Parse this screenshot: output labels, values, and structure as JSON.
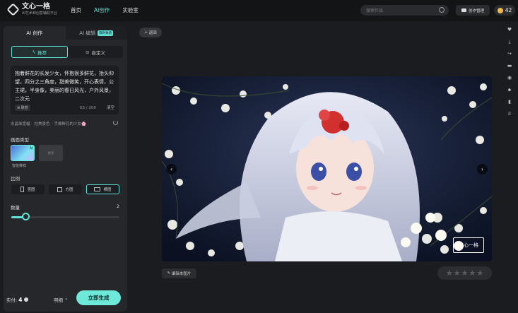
{
  "header": {
    "logo_title": "文心一格",
    "logo_sub": "AI艺术和创意辅助平台",
    "nav": [
      "首页",
      "AI创作",
      "实验室"
    ],
    "nav_active": 1,
    "search_placeholder": "搜索作品",
    "manage_label": "创作管理",
    "coins": "42"
  },
  "panel": {
    "tab_create": "AI 创作",
    "tab_edit": "AI 编辑",
    "tab_edit_badge": "限时体验",
    "mode_recommend": "推荐",
    "mode_custom": "自定义",
    "prompt": "抱着鲜花的长发少女，怀抱很多鲜花，抬头仰望，四分之三角度，甜美微笑，开心表情，公主裙，半身像，美丽的春日风光，户外风景，二次元",
    "assoc_label": "联想",
    "char_count": "63 / 200",
    "clear_label": "清空",
    "suggestions": [
      "水晶球宽幅",
      "柱美景色",
      "手捧鲜花的少女🌸"
    ],
    "style_label": "画面类型",
    "style_card_caption": "智能推荐",
    "style_more": "更多",
    "ratio_label": "比例",
    "ratios": [
      "竖图",
      "方图",
      "横图"
    ],
    "ratio_selected": 2,
    "count_label": "数量",
    "count_value": "2",
    "count_fraction": 0.16,
    "cost_label": "实付:",
    "cost_value": "4",
    "details_label": "明细",
    "generate_label": "立即生成"
  },
  "main": {
    "back_label": "返回",
    "watermark": "文心一格",
    "edit_label": "编辑本图片",
    "rating_stars": 5,
    "rating_value": 0
  },
  "colors": {
    "accent": "#5fe3d4",
    "background": "#1b1c1f",
    "panel": "#26272b"
  }
}
